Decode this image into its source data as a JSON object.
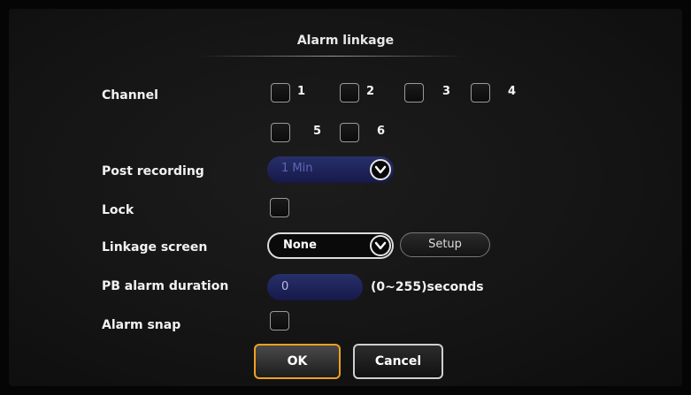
{
  "dialog": {
    "title": "Alarm linkage"
  },
  "channel": {
    "label": "Channel",
    "options": [
      {
        "num": "1",
        "checked": false
      },
      {
        "num": "2",
        "checked": false
      },
      {
        "num": "3",
        "checked": false
      },
      {
        "num": "4",
        "checked": false
      },
      {
        "num": "5",
        "checked": false
      },
      {
        "num": "6",
        "checked": false
      }
    ]
  },
  "post_recording": {
    "label": "Post recording",
    "value": "1 Min",
    "enabled": false
  },
  "lock": {
    "label": "Lock",
    "checked": false
  },
  "linkage_screen": {
    "label": "Linkage screen",
    "value": "None",
    "setup_label": "Setup"
  },
  "pb_alarm_duration": {
    "label": "PB alarm duration",
    "value": "0",
    "range_text": "(0~255)seconds"
  },
  "alarm_snap": {
    "label": "Alarm snap",
    "checked": false
  },
  "buttons": {
    "ok": "OK",
    "cancel": "Cancel"
  },
  "colors": {
    "ok_border": "#f0a020",
    "disabled_field": "#1f2560",
    "background": "#141414"
  },
  "icons": {
    "dropdown": "chevron-down-circle-icon"
  }
}
